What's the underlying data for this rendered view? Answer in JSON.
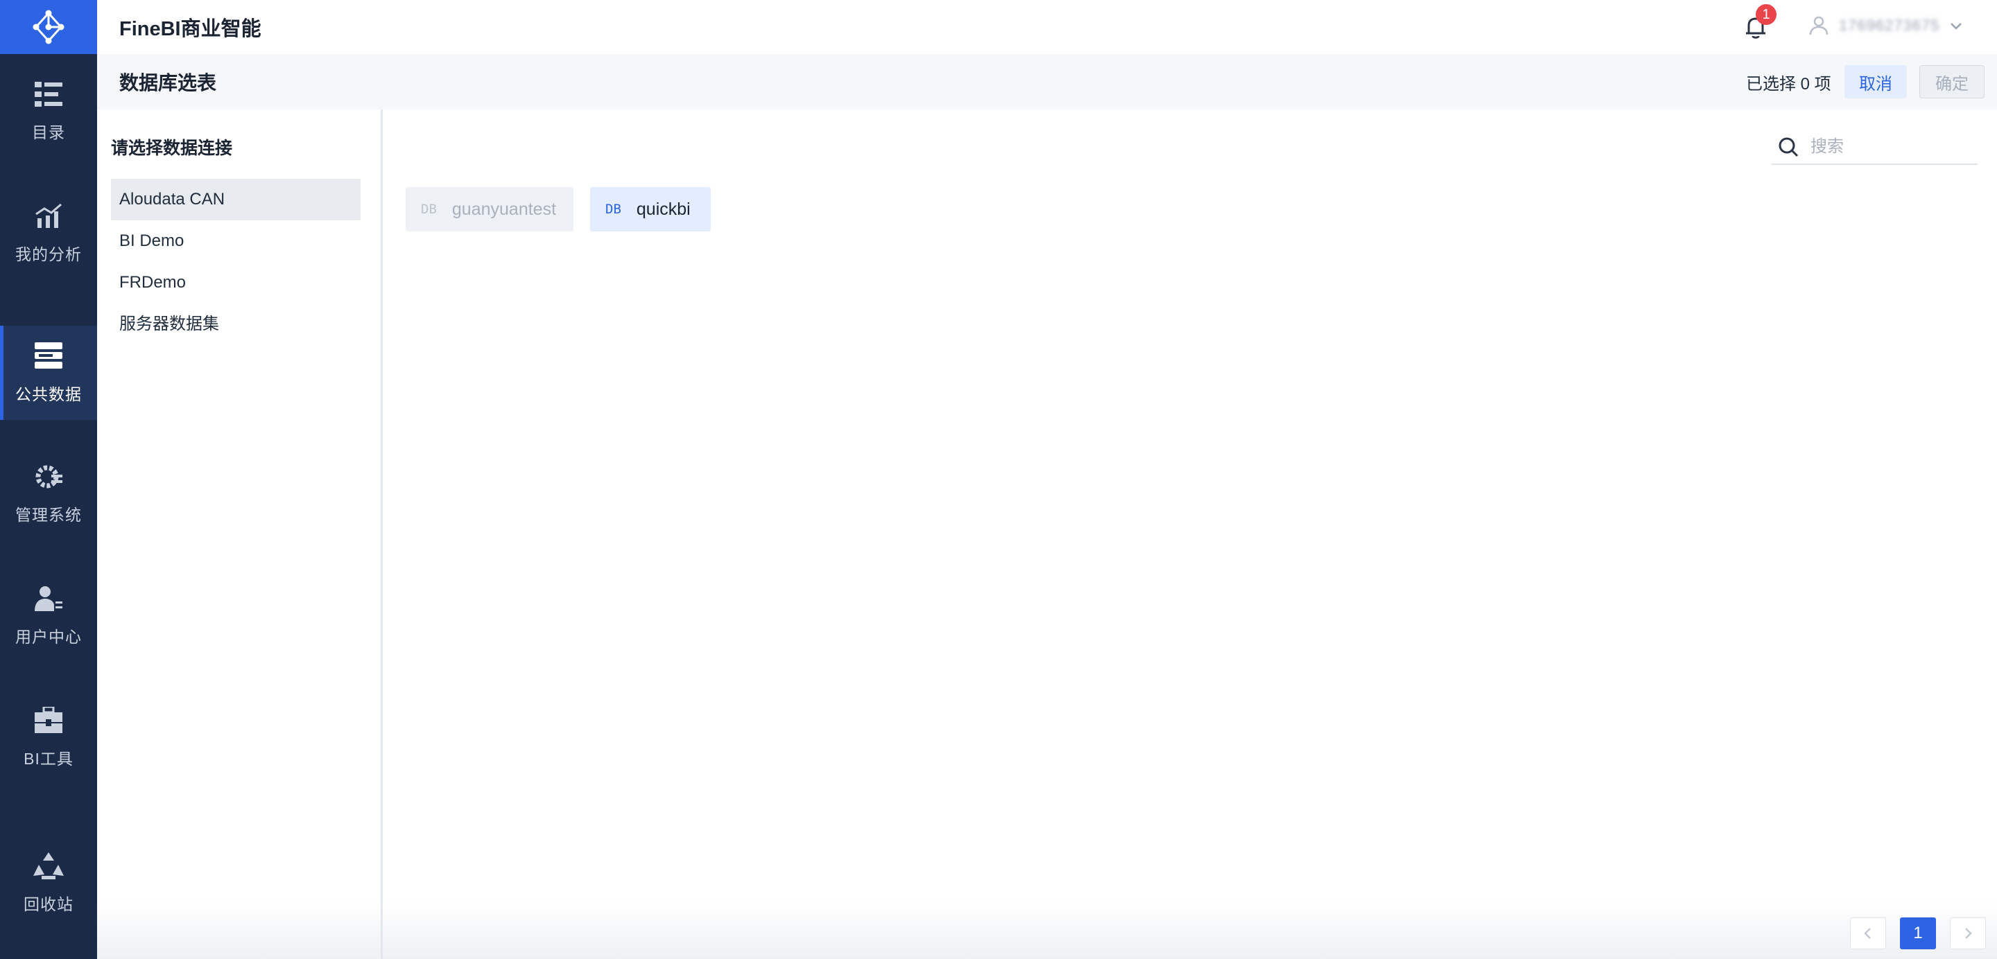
{
  "app": {
    "brand": "FineBI商业智能",
    "notification_count": "1",
    "user_name": "17696273675"
  },
  "sidebar": {
    "items": [
      {
        "label": "目录",
        "icon": "catalog-icon"
      },
      {
        "label": "我的分析",
        "icon": "analysis-chart-icon"
      },
      {
        "label": "公共数据",
        "icon": "public-data-icon",
        "active": true
      },
      {
        "label": "管理系统",
        "icon": "gear-icon"
      },
      {
        "label": "用户中心",
        "icon": "user-center-icon"
      },
      {
        "label": "BI工具",
        "icon": "toolbox-icon"
      },
      {
        "label": "回收站",
        "icon": "recycle-icon"
      }
    ]
  },
  "titlebar": {
    "title": "数据库选表",
    "selected_info": "已选择 0 项",
    "cancel_label": "取消",
    "confirm_label": "确定"
  },
  "connections": {
    "title": "请选择数据连接",
    "items": [
      {
        "label": "Aloudata CAN",
        "selected": true
      },
      {
        "label": "BI Demo"
      },
      {
        "label": "FRDemo"
      },
      {
        "label": "服务器数据集"
      }
    ]
  },
  "main": {
    "search_placeholder": "搜索",
    "databases": [
      {
        "tag": "DB",
        "name": "guanyuantest",
        "state": "disabled"
      },
      {
        "tag": "DB",
        "name": "quickbi",
        "state": "active"
      }
    ],
    "pagination": {
      "current": "1"
    }
  },
  "colors": {
    "sidebar_bg": "#1b2a47",
    "accent": "#2c64e3",
    "badge": "#e8444a"
  }
}
